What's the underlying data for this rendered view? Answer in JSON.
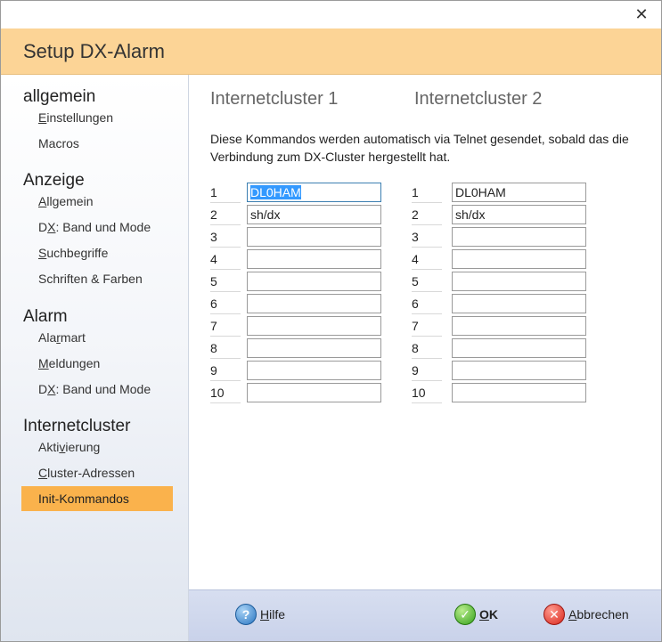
{
  "window": {
    "title": "Setup DX-Alarm",
    "close_glyph": "✕"
  },
  "sidebar": {
    "sections": [
      {
        "label": "allgemein",
        "items": [
          {
            "label": "Einstellungen",
            "accel": "E"
          },
          {
            "label": "Macros",
            "accel": ""
          }
        ]
      },
      {
        "label": "Anzeige",
        "items": [
          {
            "label": "Allgemein",
            "accel": "A"
          },
          {
            "label": "DX: Band und Mode",
            "accel": "X"
          },
          {
            "label": "Suchbegriffe",
            "accel": "S"
          },
          {
            "label": "Schriften & Farben",
            "accel": ""
          }
        ]
      },
      {
        "label": "Alarm",
        "items": [
          {
            "label": "Alarmart",
            "accel": "r"
          },
          {
            "label": "Meldungen",
            "accel": "M"
          },
          {
            "label": "DX: Band und Mode",
            "accel": "X"
          }
        ]
      },
      {
        "label": "Internetcluster",
        "items": [
          {
            "label": "Aktivierung",
            "accel": "v"
          },
          {
            "label": "Cluster-Adressen",
            "accel": "C"
          },
          {
            "label": "Init-Kommandos",
            "accel": "",
            "selected": true
          }
        ]
      }
    ]
  },
  "main": {
    "col1_title": "Internetcluster 1",
    "col2_title": "Internetcluster 2",
    "description": "Diese Kommandos werden automatisch via Telnet gesendet, sobald das die Verbindung zum DX-Cluster hergestellt hat.",
    "row_numbers": [
      "1",
      "2",
      "3",
      "4",
      "5",
      "6",
      "7",
      "8",
      "9",
      "10"
    ],
    "cluster1_commands": [
      "DL0HAM",
      "sh/dx",
      "",
      "",
      "",
      "",
      "",
      "",
      "",
      ""
    ],
    "cluster2_commands": [
      "DL0HAM",
      "sh/dx",
      "",
      "",
      "",
      "",
      "",
      "",
      "",
      ""
    ]
  },
  "footer": {
    "help_label": "Hilfe",
    "ok_label": "OK",
    "cancel_label": "Abbrechen",
    "help_glyph": "?",
    "ok_glyph": "✓",
    "cancel_glyph": "✕"
  },
  "colors": {
    "header_bg": "#fcd496",
    "selected_item_bg": "#fab24c",
    "focus_border": "#3c7fb1",
    "selection_bg": "#3399ff"
  },
  "icons": {
    "help": "help-icon",
    "ok": "ok-check-icon",
    "cancel": "cancel-x-icon",
    "close": "close-icon"
  }
}
